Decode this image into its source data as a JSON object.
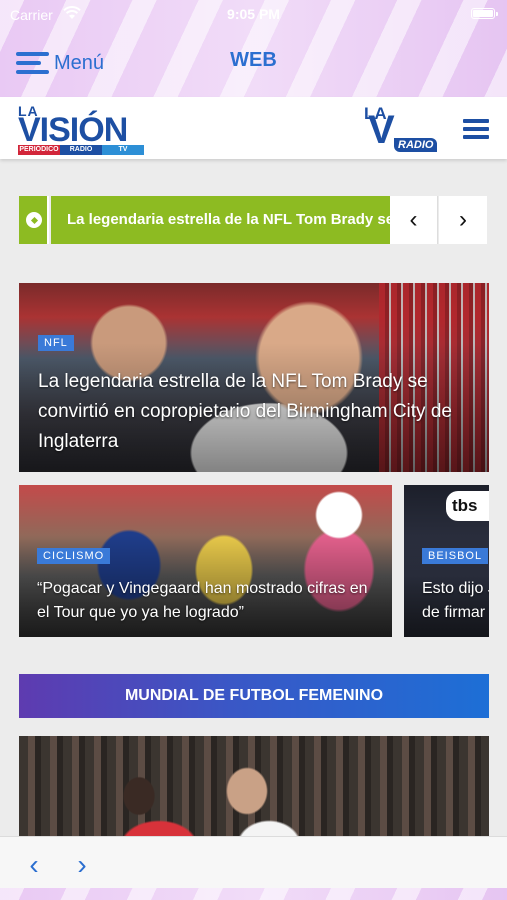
{
  "status_bar": {
    "carrier": "Carrier",
    "time": "9:05 PM"
  },
  "nav": {
    "menu_label": "Menú",
    "title": "WEB"
  },
  "site_header": {
    "logo_la": "LA",
    "logo_name": "VISIÓN",
    "logo_subs": [
      "PERIÓDICO",
      "RADIO",
      "TV"
    ],
    "radio_logo_la": "LA",
    "radio_logo_v": "V",
    "radio_logo_radio": "RADIO"
  },
  "ticker": {
    "text": "La legendaria estrella de la NFL Tom Brady se convirtió en copropietario del Birmingham City de Inglaterra",
    "prev_label": "‹",
    "next_label": "›"
  },
  "hero": {
    "category": "NFL",
    "title": "La legendaria estrella de la NFL Tom Brady se convirtió en copropietario del Birmingham City de Inglaterra"
  },
  "cards": [
    {
      "category": "CICLISMO",
      "title_line1": "“Pogacar y Vingegaard han mostrado cifras en",
      "title_line2": "el Tour que yo ya he logrado”"
    },
    {
      "category": "BEISBOL",
      "title_line1": "Esto dijo J",
      "title_line2": "de firmar",
      "logo": "tbs"
    }
  ],
  "section_banner": {
    "label": "MUNDIAL DE FUTBOL FEMENINO"
  },
  "toolbar": {
    "back_label": "‹",
    "forward_label": "›"
  },
  "colors": {
    "accent_blue": "#2c6fd0",
    "brand_blue": "#1d4fa3",
    "ticker_green": "#8dbb22",
    "badge_blue": "#3a7ad8",
    "banner_gradient_start": "#5e3bb0",
    "banner_gradient_end": "#1d6fd6",
    "topbar_purple": "#ecd0f6"
  },
  "icons": [
    "wifi-icon",
    "battery-icon",
    "hamburger-icon",
    "site-menu-icon",
    "soccer-ball-icon",
    "chevron-left-icon",
    "chevron-right-icon"
  ]
}
